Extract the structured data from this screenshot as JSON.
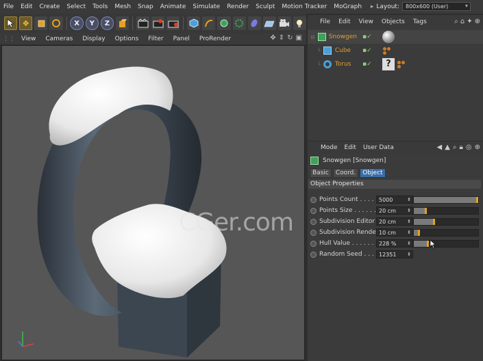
{
  "menu": [
    "File",
    "Edit",
    "Create",
    "Select",
    "Tools",
    "Mesh",
    "Snap",
    "Animate",
    "Simulate",
    "Render",
    "Sculpt",
    "Motion Tracker",
    "MoGraph"
  ],
  "layout": {
    "label": "Layout:",
    "value": "800x600 (User)"
  },
  "toolbar": {
    "x": "X",
    "y": "Y",
    "z": "Z"
  },
  "viewport": {
    "menu": [
      "View",
      "Cameras",
      "Display",
      "Options",
      "Filter",
      "Panel",
      "ProRender"
    ],
    "watermark": "CGer.com"
  },
  "object_manager": {
    "menu": [
      "File",
      "Edit",
      "View",
      "Objects",
      "Tags"
    ],
    "objects": [
      {
        "name": "Snowgen",
        "icon": "snowgen-icon"
      },
      {
        "name": "Cube",
        "icon": "cube-icon"
      },
      {
        "name": "Torus",
        "icon": "torus-icon"
      }
    ]
  },
  "attributes": {
    "menu": [
      "Mode",
      "Edit",
      "User Data"
    ],
    "object_title": "Snowgen [Snowgen]",
    "tabs": [
      "Basic",
      "Coord.",
      "Object"
    ],
    "active_tab": "Object",
    "section": "Object Properties",
    "props": [
      {
        "label": "Points Count . . . . .",
        "value": "5000",
        "slider": 1.0
      },
      {
        "label": "Points Size . . . . . . .",
        "value": "20 cm",
        "slider": 0.2
      },
      {
        "label": "Subdivision Editor",
        "value": "20 cm",
        "slider": 0.33
      },
      {
        "label": "Subdivision Render",
        "value": "10 cm",
        "slider": 0.1
      },
      {
        "label": "Hull Value . . . . . . .",
        "value": "228 %",
        "slider": 0.23
      },
      {
        "label": "Random Seed . . . .",
        "value": "12351",
        "slider": null
      }
    ]
  },
  "colors": {
    "accent": "#e8a020",
    "selection_blue": "#3b6ea8",
    "object_name": "#e0a030"
  }
}
